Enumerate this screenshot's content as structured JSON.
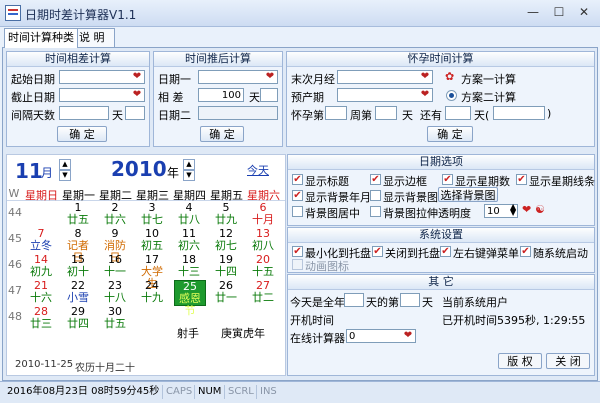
{
  "window": {
    "title": "日期时差计算器V1.1"
  },
  "tabs": [
    "时间计算种类",
    "说 明"
  ],
  "panel_diff": {
    "header": "时间相差计算",
    "start_label": "起始日期",
    "end_label": "截止日期",
    "interval_label": "间隔天数",
    "unit": "天",
    "button": "确 定"
  },
  "panel_shift": {
    "header": "时间推后计算",
    "date1_label": "日期一",
    "diff_label": "相 差",
    "diff_value": "100",
    "unit": "天",
    "date2_label": "日期二",
    "button": "确 定"
  },
  "panel_preg": {
    "header": "怀孕时间计算",
    "last_period_label": "末次月经",
    "due_label": "预产期",
    "option1": "方案一计算",
    "option2": "方案二计算",
    "week_prefix": "怀孕第",
    "week_label": "周第",
    "day_label": "天",
    "remain_label": "还有",
    "remain_unit": "天(",
    "remain_close": ")",
    "button": "确 定"
  },
  "calendar": {
    "month": "11",
    "month_unit": "月",
    "year": "2010",
    "year_unit": "年",
    "today_link": "今天",
    "week_col": "W",
    "weekdays": [
      "星期日",
      "星期一",
      "星期二",
      "星期三",
      "星期四",
      "星期五",
      "星期六"
    ],
    "weeks": [
      "44",
      "45",
      "46",
      "47",
      "48"
    ],
    "rows": [
      [
        [
          "",
          ""
        ],
        [
          "1",
          "廿五"
        ],
        [
          "2",
          "廿六"
        ],
        [
          "3",
          "廿七"
        ],
        [
          "4",
          "廿八"
        ],
        [
          "5",
          "廿九"
        ],
        [
          "6",
          "十月"
        ]
      ],
      [
        [
          "7",
          "立冬"
        ],
        [
          "8",
          "记者日"
        ],
        [
          "9",
          "消防日"
        ],
        [
          "10",
          "初五"
        ],
        [
          "11",
          "初六"
        ],
        [
          "12",
          "初七"
        ],
        [
          "13",
          "初八"
        ]
      ],
      [
        [
          "14",
          "初九"
        ],
        [
          "15",
          "初十"
        ],
        [
          "16",
          "十一"
        ],
        [
          "17",
          "大学生"
        ],
        [
          "18",
          "十三"
        ],
        [
          "19",
          "十四"
        ],
        [
          "20",
          "十五"
        ]
      ],
      [
        [
          "21",
          "十六"
        ],
        [
          "22",
          "小雪"
        ],
        [
          "23",
          "十八"
        ],
        [
          "24",
          "十九"
        ],
        [
          "25",
          "感恩节"
        ],
        [
          "26",
          "廿一"
        ],
        [
          "27",
          "廿二"
        ]
      ],
      [
        [
          "28",
          "廿三"
        ],
        [
          "29",
          "廿四"
        ],
        [
          "30",
          "廿五"
        ],
        [
          "",
          ""
        ],
        [
          "",
          ""
        ],
        [
          "",
          ""
        ],
        [
          "",
          ""
        ]
      ]
    ],
    "zodiac": "射手",
    "ganzhi": "庚寅虎年",
    "footer_date": "2010-11-25",
    "footer_lunar": "农历十月二十"
  },
  "date_options": {
    "header": "日期选项",
    "items": [
      "显示标题",
      "显示边框",
      "显示星期数",
      "显示星期线条",
      "显示背景年月",
      "显示背景图",
      "背景图居中",
      "背景图拉伸"
    ],
    "select_bg_button": "选择背景图",
    "opacity_label": "透明度",
    "opacity_value": "10"
  },
  "system": {
    "header": "系统设置",
    "items": [
      "最小化到托盘",
      "关闭到托盘",
      "左右键弹菜单",
      "随系统启动",
      "动画图标"
    ]
  },
  "other": {
    "header": "其 它",
    "today_is": "今天是全年",
    "nth_day": "天的第",
    "day_unit": "天",
    "current_user": "当前系统用户",
    "boot_time_label": "开机时间",
    "uptime": "已开机时间5395秒, 1:29:55",
    "online_label": "在线计算器",
    "online_value": "0",
    "copyright_button": "版 权",
    "close_button": "关 闭"
  },
  "statusbar": {
    "datetime": "2016年08月23日 08时59分45秒",
    "caps": "CAPS",
    "num": "NUM",
    "scrl": "SCRL",
    "ins": "INS"
  },
  "colors": {
    "red": "#d81c1c",
    "blue": "#1a3fb0",
    "green": "#0a7a0a",
    "highlight": "#1e9a2e"
  }
}
